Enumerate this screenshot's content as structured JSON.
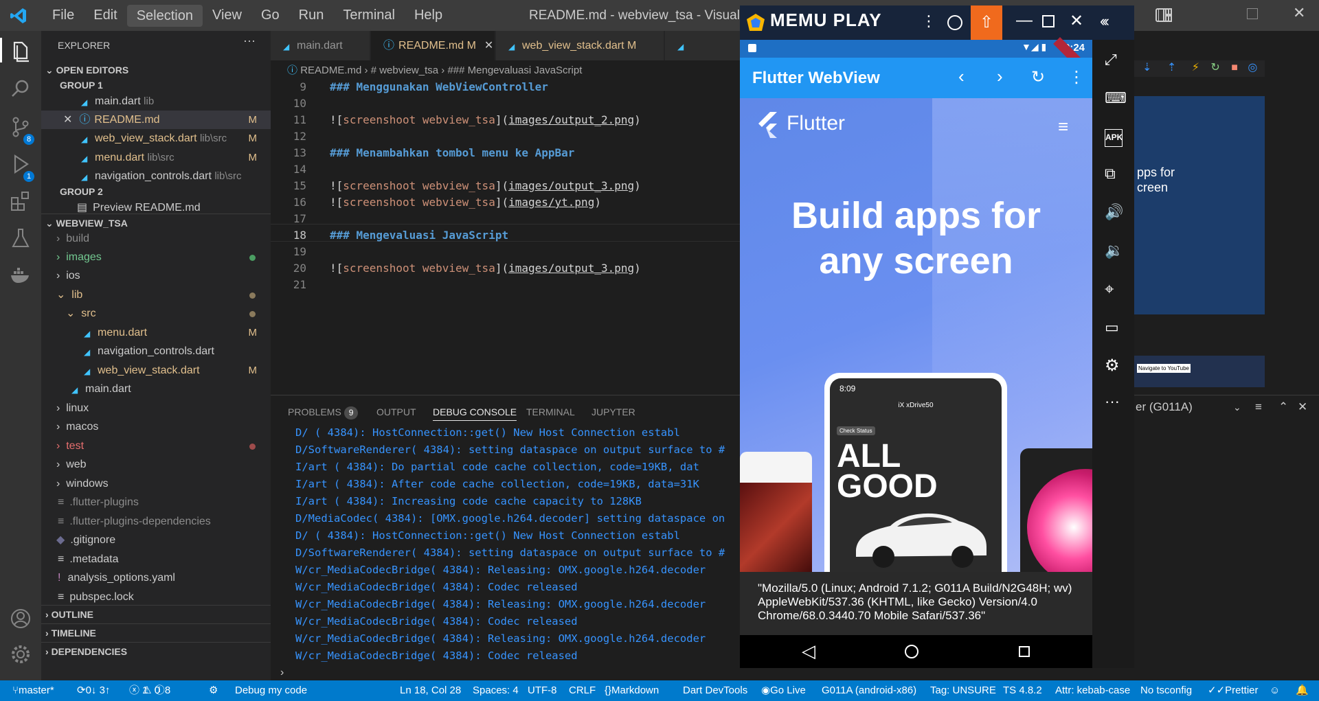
{
  "titlebar": {
    "menu": [
      "File",
      "Edit",
      "Selection",
      "View",
      "Go",
      "Run",
      "Terminal",
      "Help"
    ],
    "window_title": "README.md - webview_tsa - Visual Stu"
  },
  "activity": {
    "scm_badge": "8",
    "debug_badge": "1"
  },
  "sidebar": {
    "title": "EXPLORER",
    "open_editors": "OPEN EDITORS",
    "group1": "GROUP 1",
    "group2": "GROUP 2",
    "open_files": [
      {
        "name": "main.dart",
        "path": "lib",
        "mod": ""
      },
      {
        "name": "README.md",
        "path": "",
        "mod": "M"
      },
      {
        "name": "web_view_stack.dart",
        "path": "lib\\src",
        "mod": "M"
      },
      {
        "name": "menu.dart",
        "path": "lib\\src",
        "mod": "M"
      },
      {
        "name": "navigation_controls.dart",
        "path": "lib\\src",
        "mod": ""
      }
    ],
    "preview": "Preview README.md",
    "project": "WEBVIEW_TSA",
    "tree": [
      {
        "name": "build"
      },
      {
        "name": "images"
      },
      {
        "name": "ios"
      },
      {
        "name": "lib"
      },
      {
        "name": "src"
      },
      {
        "name": "menu.dart",
        "mod": "M"
      },
      {
        "name": "navigation_controls.dart"
      },
      {
        "name": "web_view_stack.dart",
        "mod": "M"
      },
      {
        "name": "main.dart"
      },
      {
        "name": "linux"
      },
      {
        "name": "macos"
      },
      {
        "name": "test"
      },
      {
        "name": "web"
      },
      {
        "name": "windows"
      },
      {
        "name": ".flutter-plugins"
      },
      {
        "name": ".flutter-plugins-dependencies"
      },
      {
        "name": ".gitignore"
      },
      {
        "name": ".metadata"
      },
      {
        "name": "analysis_options.yaml"
      },
      {
        "name": "pubspec.lock"
      }
    ],
    "outline": "OUTLINE",
    "timeline": "TIMELINE",
    "dependencies": "DEPENDENCIES"
  },
  "tabs": [
    {
      "label": "main.dart",
      "mod": ""
    },
    {
      "label": "README.md",
      "mod": "M"
    },
    {
      "label": "web_view_stack.dart",
      "mod": "M"
    }
  ],
  "breadcrumb": {
    "file": "README.md",
    "h1": "# webview_tsa",
    "h3": "### Mengevaluasi JavaScript"
  },
  "editor": {
    "lines": [
      {
        "n": "9",
        "head": "### Menggunakan WebViewController"
      },
      {
        "n": "10"
      },
      {
        "n": "11",
        "alt": "screenshoot webview_tsa",
        "url": "images/output_2.png"
      },
      {
        "n": "12"
      },
      {
        "n": "13",
        "head": "### Menambahkan tombol menu ke AppBar"
      },
      {
        "n": "14"
      },
      {
        "n": "15",
        "alt": "screenshoot webview_tsa",
        "url": "images/output_3.png"
      },
      {
        "n": "16",
        "alt": "screenshoot webview_tsa",
        "url": "images/yt.png"
      },
      {
        "n": "17"
      },
      {
        "n": "18",
        "head": "### Mengevaluasi JavaScript"
      },
      {
        "n": "19"
      },
      {
        "n": "20",
        "alt": "screenshoot webview_tsa",
        "url": "images/output_3.png"
      },
      {
        "n": "21"
      }
    ]
  },
  "panel": {
    "tabs": [
      "PROBLEMS",
      "OUTPUT",
      "DEBUG CONSOLE",
      "TERMINAL",
      "JUPYTER"
    ],
    "problems_count": "9",
    "device": "er (G011A)",
    "console": [
      "D/       ( 4384): HostConnection::get() New Host Connection establ",
      "D/SoftwareRenderer( 4384): setting dataspace on output surface to #",
      "I/art     ( 4384): Do partial code cache collection, code=19KB, dat",
      "I/art     ( 4384): After code cache collection, code=19KB, data=31K",
      "I/art     ( 4384): Increasing code cache capacity to 128KB",
      "D/MediaCodec( 4384): [OMX.google.h264.decoder] setting dataspace on",
      "D/       ( 4384): HostConnection::get() New Host Connection establ",
      "D/SoftwareRenderer( 4384): setting dataspace on output surface to #",
      "W/cr_MediaCodecBridge( 4384): Releasing: OMX.google.h264.decoder",
      "W/cr_MediaCodecBridge( 4384): Codec released",
      "W/cr_MediaCodecBridge( 4384): Releasing: OMX.google.h264.decoder",
      "W/cr_MediaCodecBridge( 4384): Codec released",
      "W/cr_MediaCodecBridge( 4384): Releasing: OMX.google.h264.decoder",
      "W/cr_MediaCodecBridge( 4384): Codec released"
    ]
  },
  "emulator": {
    "brand": "MEMU PLAY",
    "time": "9:24",
    "app_title": "Flutter WebView",
    "flutter_logo_text": "Flutter",
    "hero_line1": "Build apps for",
    "hero_line2": "any screen",
    "phone_time": "8:09",
    "phone_title": "iX xDrive50",
    "phone_chip": "Check Status",
    "phone_big1": "ALL",
    "phone_big2": "GOOD",
    "user_agent": "\"Mozilla/5.0 (Linux; Android 7.1.2; G011A Build/N2G48H; wv) AppleWebKit/537.36 (KHTML, like Gecko) Version/4.0 Chrome/68.0.3440.70 Mobile Safari/537.36\"",
    "bg_text": "pps for creen",
    "bg_youtube": "Navigate to YouTube"
  },
  "statusbar": {
    "branch": "master*",
    "sync": "0↓ 3↑",
    "errors": "1",
    "warnings": "0",
    "info": "8",
    "debug": "Debug my code",
    "position": "Ln 18, Col 28",
    "spaces": "Spaces: 4",
    "encoding": "UTF-8",
    "eol": "CRLF",
    "language": "Markdown",
    "devtools": "Dart DevTools",
    "golive": "Go Live",
    "device": "G011A (android-x86)",
    "tag": "Tag: UNSURE",
    "ts": "TS 4.8.2",
    "attr": "Attr: kebab-case",
    "tsconfig": "No tsconfig",
    "prettier": "Prettier"
  }
}
